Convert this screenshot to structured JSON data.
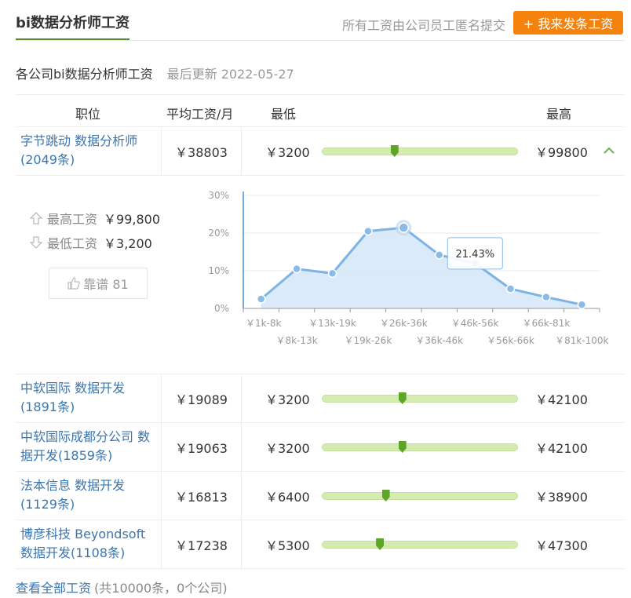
{
  "header": {
    "title": "bi数据分析师工资",
    "note": "所有工资由公司员工匿名提交",
    "submit_button": "+ 我来发条工资"
  },
  "subtitle": {
    "text": "各公司bi数据分析师工资",
    "updated": "最后更新  2022-05-27"
  },
  "table": {
    "headers": {
      "position": "职位",
      "avg": "平均工资/月",
      "min": "最低",
      "max": "最高"
    },
    "rows": [
      {
        "name": "字节跳动 数据分析师",
        "count": "(2049条)",
        "avg": "￥38803",
        "min": "￥3200",
        "max": "￥99800",
        "marker_pos": 0.37
      },
      {
        "name": "中软国际 数据开发",
        "count": "(1891条)",
        "avg": "￥19089",
        "min": "￥3200",
        "max": "￥42100",
        "marker_pos": 0.41
      },
      {
        "name": "中软国际成都分公司 数",
        "count": "据开发(1859条)",
        "avg": "￥19063",
        "min": "￥3200",
        "max": "￥42100",
        "marker_pos": 0.41
      },
      {
        "name": "法本信息 数据开发",
        "count": "(1129条)",
        "avg": "￥16813",
        "min": "￥6400",
        "max": "￥38900",
        "marker_pos": 0.325
      },
      {
        "name": "博彦科技 Beyondsoft",
        "count": "数据开发(1108条)",
        "avg": "￥17238",
        "min": "￥5300",
        "max": "￥47300",
        "marker_pos": 0.295
      }
    ]
  },
  "detail": {
    "max_label": "最高工资",
    "max_value": "￥99,800",
    "min_label": "最低工资",
    "min_value": "￥3,200",
    "vote": "靠谱 81"
  },
  "chart_data": {
    "type": "area",
    "categories": [
      "￥1k-8k",
      "￥8k-13k",
      "￥13k-19k",
      "￥19k-26k",
      "￥26k-36k",
      "￥36k-46k",
      "￥46k-56k",
      "￥56k-66k",
      "￥66k-81k",
      "￥81k-100k"
    ],
    "values": [
      2.5,
      10.5,
      9.3,
      20.5,
      21.43,
      14.2,
      12.0,
      5.2,
      3.0,
      1.0
    ],
    "yticks": [
      "0%",
      "10%",
      "20%",
      "30%"
    ],
    "ylim": [
      0,
      30
    ],
    "tooltip": "21.43%",
    "highlight_index": 4,
    "colors": {
      "line": "#7eb3e6",
      "fill": "#d6e8f7",
      "point": "#8bbbe8",
      "axis": "#4a90d9",
      "grid": "#e8e8e8"
    }
  },
  "footer": {
    "link": "查看全部工资",
    "count": "(共10000条，0个公司)"
  }
}
